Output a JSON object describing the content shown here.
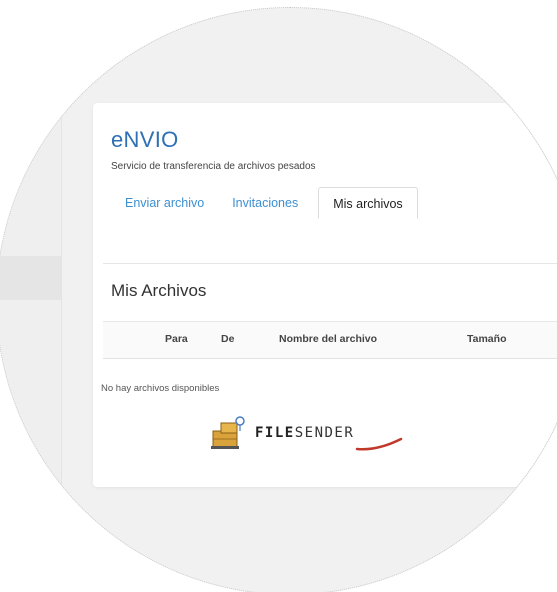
{
  "app": {
    "title": "eNVIO",
    "subtitle": "Servicio de transferencia de archivos pesados"
  },
  "tabs": [
    {
      "label": "Enviar archivo",
      "active": false
    },
    {
      "label": "Invitaciones",
      "active": false
    },
    {
      "label": "Mis archivos",
      "active": true
    }
  ],
  "files_section": {
    "title": "Mis Archivos",
    "columns": [
      "Para",
      "De",
      "Nombre del archivo",
      "Tamaño"
    ],
    "rows": [],
    "empty_message": "No hay archivos disponibles"
  },
  "logo": {
    "text_bold": "FILE",
    "text_light": "SENDER",
    "icon": "filesender-boxes-icon"
  },
  "colors": {
    "brand": "#2f6fb5",
    "tab_link": "#3d8fd0",
    "logo_swoosh": "#c0392b"
  }
}
